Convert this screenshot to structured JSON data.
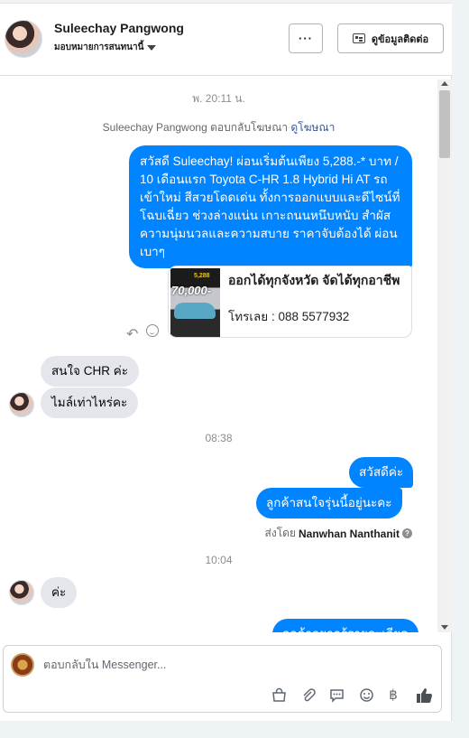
{
  "header": {
    "name": "Suleechay Pangwong",
    "assign_label": "มอบหมายการสนทนานี้",
    "more_label": "···",
    "contact_label": "ดูข้อมูลติดต่อ"
  },
  "thread": {
    "timestamp1": "พ. 20:11 น.",
    "reply_note_prefix": "Suleechay Pangwong ตอบกลับโฆษณา",
    "reply_note_link": "ดูโฆษณา",
    "ad_message": "สวัสดี Suleechay! ผ่อนเริ่มต้นเพียง 5,288.-* บาท / 10 เดือนแรก Toyota C-HR 1.8 Hybrid Hi AT รถเข้าใหม่ สีสวยโดดเด่น ทั้งการออกแบบและดีไซน์ที่โฉบเฉี่ยว ช่วงล่างแน่น เกาะถนนหนึบหนับ สำผัสความนุ่มนวลและความสบาย ราคาจับต้องได้ ผ่อนเบาๆ",
    "ad_card": {
      "thumb_big": "70,000-",
      "thumb_small": "5,288",
      "title": "ออกได้ทุกจังหวัด จัดได้ทุกอาชีพ",
      "phone": "โทรเลย : 088 5577932"
    },
    "incoming1": "สนใจ CHR ค่ะ",
    "incoming2": "ไมล์เท่าไหร่คะ",
    "timestamp2": "08:38",
    "outgoing1": "สวัสดีค่ะ",
    "outgoing2": "ลูกค้าสนใจรุ่นนี้อยู่นะคะ",
    "sent_by_prefix": "ส่งโดย",
    "sent_by_name": "Nanwhan Nanthanit",
    "timestamp3": "10:04",
    "incoming3": "ค่ะ",
    "outgoing3_partial": "ลูกค้าอยากรู้รายละเอียด"
  },
  "composer": {
    "placeholder": "ตอบกลับใน Messenger..."
  },
  "colors": {
    "accent": "#0084ff",
    "incoming_bubble": "#e4e6eb"
  },
  "icons": [
    "more-icon",
    "contact-card-icon",
    "reply-icon",
    "smile-icon",
    "help-icon",
    "shop-bag-icon",
    "attachment-icon",
    "saved-reply-icon",
    "emoji-icon",
    "baht-icon",
    "like-icon"
  ]
}
